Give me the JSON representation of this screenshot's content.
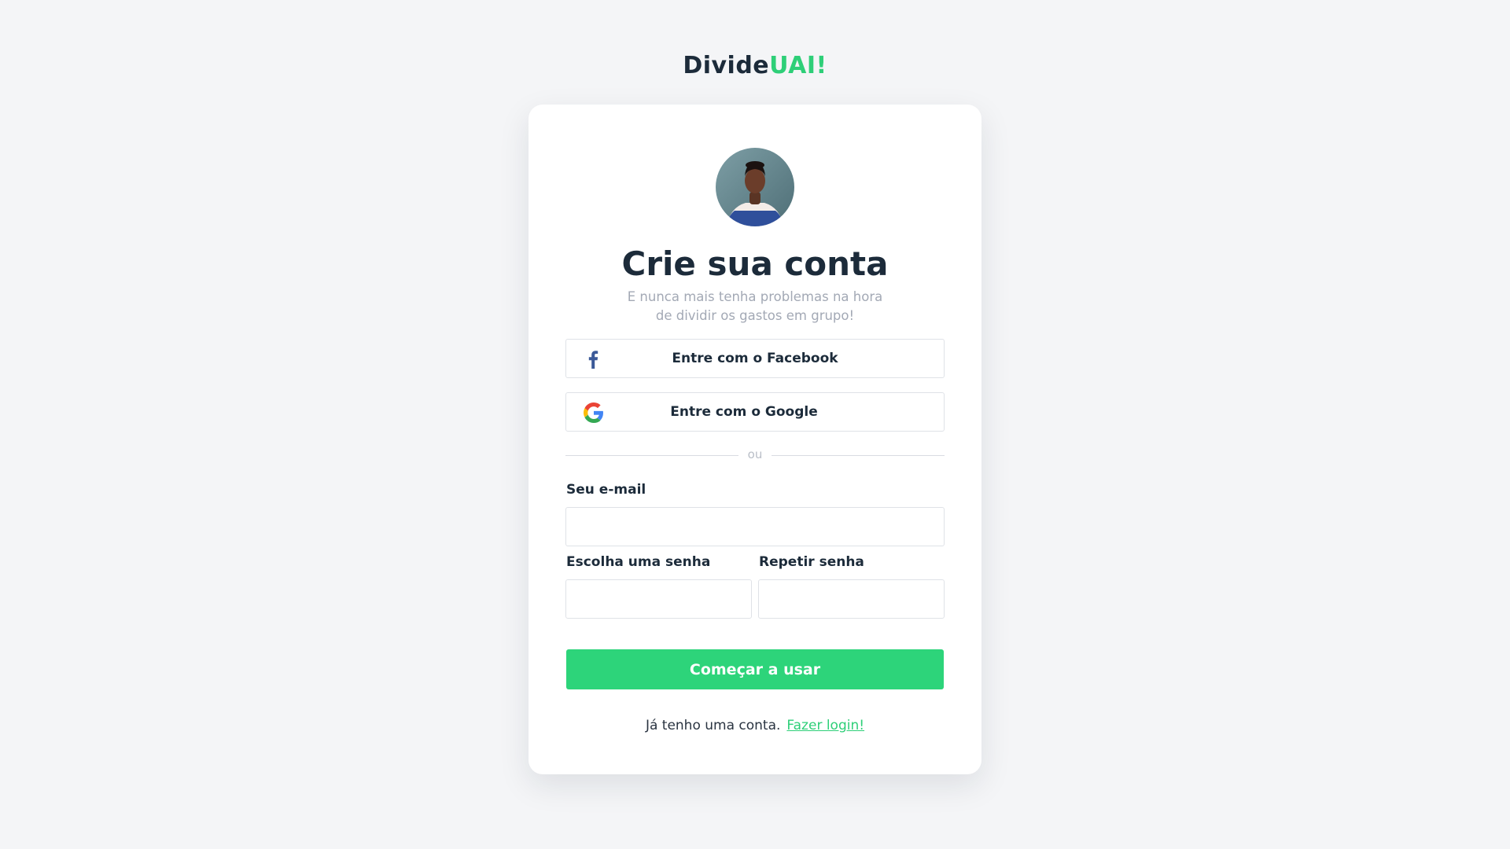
{
  "app": {
    "brand_part1": "Divide",
    "brand_part2": "UAI!"
  },
  "card": {
    "avatar_alt": "Foto do usuário",
    "title": "Crie sua conta",
    "subtitle": "E nunca mais tenha problemas na hora de dividir os gastos em grupo!",
    "social": {
      "facebook_label": "Entre com o Facebook",
      "google_label": "Entre com o Google"
    },
    "divider_text": "ou",
    "form": {
      "email_label": "Seu e-mail",
      "email_value": "",
      "password_label": "Escolha uma senha",
      "password_value": "",
      "repeat_label": "Repetir senha",
      "repeat_value": "",
      "submit_label": "Começar a usar"
    },
    "footer": {
      "text": "Já tenho uma conta.",
      "link_label": "Fazer login!"
    }
  },
  "colors": {
    "accent": "#2dd47a",
    "text_dark": "#1c2b3a",
    "text_muted": "#a3a9b5",
    "facebook_blue": "#3b5998",
    "background": "#f4f5f7"
  },
  "icons": {
    "facebook": "facebook-icon",
    "google": "google-icon"
  }
}
